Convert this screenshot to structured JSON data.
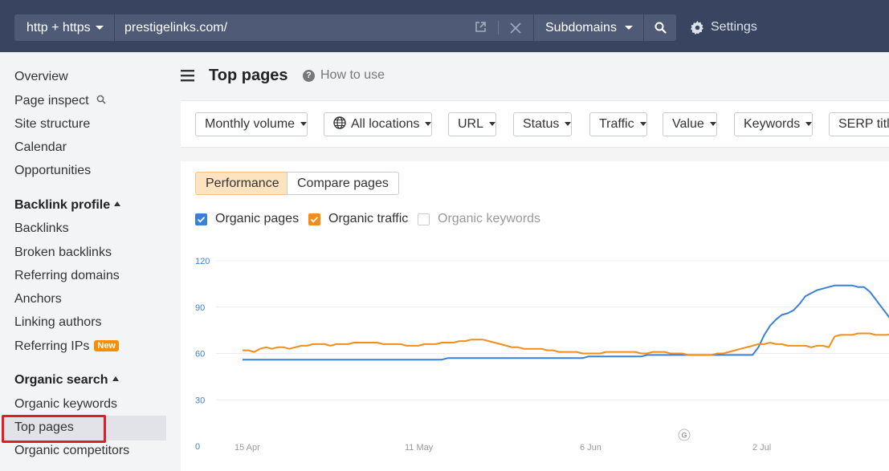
{
  "topbar": {
    "protocol": "http + https",
    "url": "prestigelinks.com/",
    "mode": "Subdomains",
    "settings": "Settings",
    "icons": [
      "external-link-icon",
      "close-icon",
      "search-icon",
      "gear-icon"
    ]
  },
  "sidebar": {
    "overview": "Overview",
    "page_inspect": "Page inspect",
    "site_structure": "Site structure",
    "calendar": "Calendar",
    "opportunities": "Opportunities",
    "backlink_profile": "Backlink profile",
    "backlinks": "Backlinks",
    "broken_backlinks": "Broken backlinks",
    "referring_domains": "Referring domains",
    "anchors": "Anchors",
    "linking_authors": "Linking authors",
    "referring_ips": "Referring IPs",
    "new_badge": "New",
    "organic_search": "Organic search",
    "organic_keywords": "Organic keywords",
    "top_pages": "Top pages",
    "organic_competitors": "Organic competitors"
  },
  "page": {
    "title": "Top pages",
    "how_to_use": "How to use"
  },
  "filters": [
    "Monthly volume",
    "All locations",
    "URL",
    "Status",
    "Traffic",
    "Value",
    "Keywords",
    "SERP titl"
  ],
  "tabs": {
    "performance": "Performance",
    "compare": "Compare pages"
  },
  "legend": {
    "organic_pages": "Organic pages",
    "organic_traffic": "Organic traffic",
    "organic_keywords": "Organic keywords"
  },
  "colors": {
    "topbar": "#394461",
    "organic_pages": "#3a80d8",
    "organic_traffic": "#f18d1c",
    "badge": "#ff8c00",
    "highlight": "#e51b23"
  },
  "chart_data": {
    "type": "line",
    "ylim": [
      0,
      120
    ],
    "y_ticks": [
      "0",
      "30",
      "60",
      "90",
      "120"
    ],
    "x_ticks": [
      "15 Apr",
      "11 May",
      "6 Jun",
      "2 Jul"
    ],
    "annotation": "G",
    "series": [
      {
        "name": "Organic pages",
        "values": [
          56,
          56,
          56,
          56,
          56,
          56,
          56,
          56,
          56,
          56,
          56,
          56,
          56,
          56,
          56,
          56,
          56,
          56,
          56,
          56,
          56,
          56,
          56,
          56,
          56,
          56,
          56,
          56,
          56,
          56,
          56,
          56,
          56,
          56,
          56,
          57,
          57,
          57,
          57,
          57,
          57,
          57,
          57,
          57,
          57,
          57,
          57,
          57,
          57,
          57,
          57,
          57,
          57,
          57,
          57,
          57,
          57,
          57,
          57,
          58,
          58,
          58,
          58,
          58,
          58,
          58,
          58,
          58,
          58,
          59,
          59,
          59,
          59,
          59,
          59,
          59,
          59,
          59,
          59,
          59,
          59,
          59,
          59,
          59,
          59,
          59,
          59,
          59,
          64,
          72,
          78,
          82,
          85,
          86,
          88,
          92,
          97,
          99,
          101,
          102,
          103,
          104,
          104,
          104,
          104,
          103,
          103,
          100,
          95,
          90,
          85,
          80,
          76,
          75,
          74,
          71,
          67,
          65,
          64,
          64
        ]
      },
      {
        "name": "Organic traffic",
        "values": [
          62,
          62,
          61,
          63,
          64,
          63,
          64,
          64,
          63,
          64,
          65,
          65,
          66,
          66,
          66,
          65,
          66,
          66,
          66,
          67,
          67,
          67,
          67,
          67,
          66,
          66,
          66,
          66,
          65,
          65,
          65,
          66,
          66,
          66,
          67,
          67,
          67,
          68,
          68,
          69,
          69,
          69,
          68,
          67,
          66,
          65,
          64,
          64,
          63,
          63,
          63,
          63,
          62,
          62,
          61,
          61,
          61,
          61,
          60,
          60,
          60,
          60,
          61,
          61,
          61,
          61,
          61,
          61,
          60,
          60,
          61,
          61,
          61,
          60,
          60,
          60,
          59,
          59,
          59,
          59,
          59,
          60,
          60,
          61,
          62,
          63,
          64,
          65,
          66,
          66,
          67,
          66,
          66,
          65,
          65,
          65,
          65,
          64,
          65,
          65,
          64,
          71,
          72,
          72,
          72,
          73,
          73,
          73,
          72,
          72,
          72,
          73,
          73,
          73,
          73,
          73,
          73,
          73,
          73,
          73
        ]
      }
    ]
  }
}
